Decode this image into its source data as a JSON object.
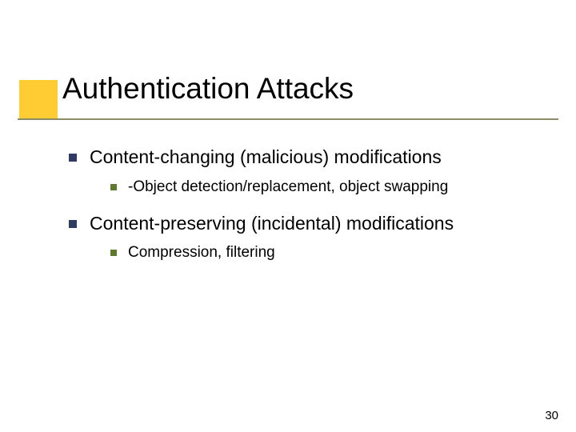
{
  "title": "Authentication Attacks",
  "bullets": {
    "item0": {
      "text": "Content-changing (malicious) modifications",
      "sub0": "-Object detection/replacement, object swapping"
    },
    "item1": {
      "text": "Content-preserving (incidental) modifications",
      "sub0": "Compression, filtering"
    }
  },
  "page_number": "30"
}
